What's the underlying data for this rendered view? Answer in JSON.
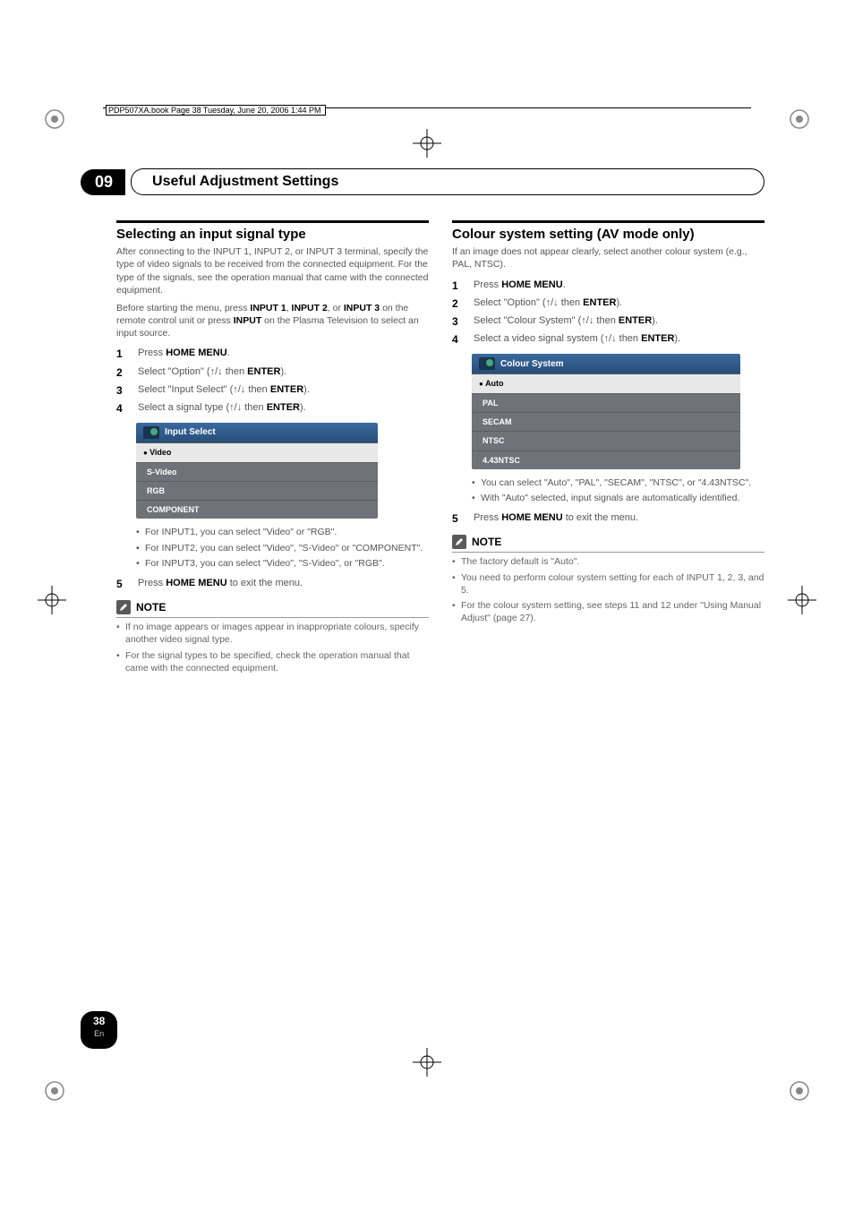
{
  "book_header": "PDP507XA.book  Page 38  Tuesday, June 20, 2006  1:44 PM",
  "chapter": {
    "number": "09",
    "title": "Useful Adjustment Settings"
  },
  "page": {
    "number": "38",
    "lang": "En"
  },
  "left": {
    "heading": "Selecting an input signal type",
    "intro": "After connecting to the INPUT 1, INPUT 2, or INPUT 3 terminal, specify the type of video signals to be received from the connected equipment. For the type of the signals, see the operation manual that came with the connected equipment.",
    "pre_step_a": "Before starting the menu, press ",
    "pre_step_b1": "INPUT 1",
    "pre_step_sep1": ", ",
    "pre_step_b2": "INPUT 2",
    "pre_step_sep2": ", or ",
    "pre_step_b3": "INPUT 3",
    "pre_step_c": " on the remote control unit or press ",
    "pre_step_b4": "INPUT",
    "pre_step_d": " on the Plasma Television to select an input source.",
    "steps": {
      "s1_a": "Press ",
      "s1_b": "HOME MENU",
      "s1_c": ".",
      "s2_a": "Select \"Option\" (",
      "s2_arr": "↑/↓",
      "s2_b": " then ",
      "s2_c": "ENTER",
      "s2_d": ").",
      "s3_a": "Select \"Input Select\" (",
      "s3_arr": "↑/↓",
      "s3_b": " then ",
      "s3_c": "ENTER",
      "s3_d": ").",
      "s4_a": "Select a signal type (",
      "s4_arr": "↑/↓",
      "s4_b": " then ",
      "s4_c": "ENTER",
      "s4_d": ").",
      "s5_a": "Press ",
      "s5_b": "HOME MENU",
      "s5_c": " to exit the menu."
    },
    "osd": {
      "title": "Input Select",
      "rows": [
        "Video",
        "S-Video",
        "RGB",
        "COMPONENT"
      ],
      "selected_index": 0
    },
    "after_osd": [
      "For INPUT1, you can select \"Video\" or \"RGB\".",
      "For INPUT2, you can select \"Video\", \"S-Video\" or \"COMPONENT\".",
      "For INPUT3, you can select \"Video\", \"S-Video\", or \"RGB\"."
    ],
    "note_label": "NOTE",
    "notes": [
      "If no image appears or images appear in inappropriate colours, specify another video signal type.",
      "For the signal types to be specified, check the operation manual that came with the connected equipment."
    ]
  },
  "right": {
    "heading": "Colour system setting (AV mode only)",
    "intro": "If an image does not appear clearly, select another colour system (e.g., PAL, NTSC).",
    "steps": {
      "s1_a": "Press ",
      "s1_b": "HOME MENU",
      "s1_c": ".",
      "s2_a": "Select \"Option\" (",
      "s2_arr": "↑/↓",
      "s2_b": " then ",
      "s2_c": "ENTER",
      "s2_d": ").",
      "s3_a": "Select \"Colour System\" (",
      "s3_arr": "↑/↓",
      "s3_b": " then ",
      "s3_c": "ENTER",
      "s3_d": ").",
      "s4_a": "Select a video signal system (",
      "s4_arr": "↑/↓",
      "s4_b": " then ",
      "s4_c": "ENTER",
      "s4_d": ").",
      "s5_a": "Press ",
      "s5_b": "HOME MENU",
      "s5_c": " to exit the menu."
    },
    "osd": {
      "title": "Colour System",
      "rows": [
        "Auto",
        "PAL",
        "SECAM",
        "NTSC",
        "4.43NTSC"
      ],
      "selected_index": 0
    },
    "after_osd": [
      "You can select \"Auto\", \"PAL\", \"SECAM\", \"NTSC\", or \"4.43NTSC\".",
      "With \"Auto\" selected, input signals are automatically identified."
    ],
    "note_label": "NOTE",
    "notes": [
      "The factory default is \"Auto\".",
      "You need to perform colour system setting for each of INPUT 1, 2, 3, and 5.",
      "For the colour system setting, see steps 11 and 12 under \"Using Manual Adjust\" (page 27)."
    ]
  }
}
